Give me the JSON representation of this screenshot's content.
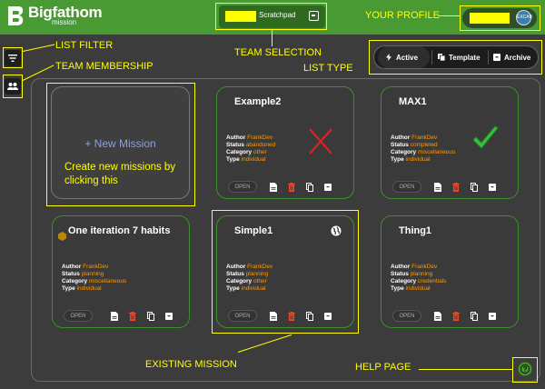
{
  "brand": {
    "name": "Bigfathom",
    "sub": "mission"
  },
  "team_selector": {
    "label": "Scratchpad"
  },
  "profile": {
    "avatar_text": "EXCAB"
  },
  "list_type": {
    "tabs": [
      {
        "label": "Active",
        "icon": "bolt-icon",
        "active": true
      },
      {
        "label": "Template",
        "icon": "copy-icon",
        "active": false
      },
      {
        "label": "Archive",
        "icon": "archive-icon",
        "active": false
      }
    ]
  },
  "new_mission": {
    "label": "+ New Mission",
    "hint": "Create new missions by clicking this"
  },
  "field_labels": {
    "author": "Author",
    "status": "Status",
    "category": "Category",
    "type": "Type"
  },
  "open_label": "OPEN",
  "missions": [
    {
      "title": "Example2",
      "author": "FrankDev",
      "status": "abandoned",
      "category": "other",
      "type": "individual",
      "status_mark": "x-icon"
    },
    {
      "title": "MAX1",
      "author": "FrankDev",
      "status": "completed",
      "category": "miscellaneous",
      "type": "individual",
      "status_mark": "checkmark-icon"
    },
    {
      "title": "One iteration 7 habits",
      "author": "FrankDev",
      "status": "planning",
      "category": "miscellaneous",
      "type": "individual",
      "status_mark": "hexagon-icon"
    },
    {
      "title": "Simple1",
      "author": "FrankDev",
      "status": "planning",
      "category": "other",
      "type": "individual",
      "status_mark": "globe-icon"
    },
    {
      "title": "Thing1",
      "author": "FrankDev",
      "status": "planning",
      "category": "credentials",
      "type": "individual",
      "status_mark": ""
    }
  ],
  "annotations": {
    "list_filter": "LIST FILTER",
    "team_membership": "TEAM MEMBERSHIP",
    "team_selection": "TEAM SELECTION",
    "list_type": "LIST TYPE",
    "your_profile": "YOUR PROFILE",
    "existing_mission": "EXISTING MISSION",
    "help_page": "HELP PAGE"
  },
  "colors": {
    "topbar": "#4a9a33",
    "accent_orange": "#ff9900",
    "annotation": "#ffff00",
    "card_border": "#3d8f2a"
  }
}
